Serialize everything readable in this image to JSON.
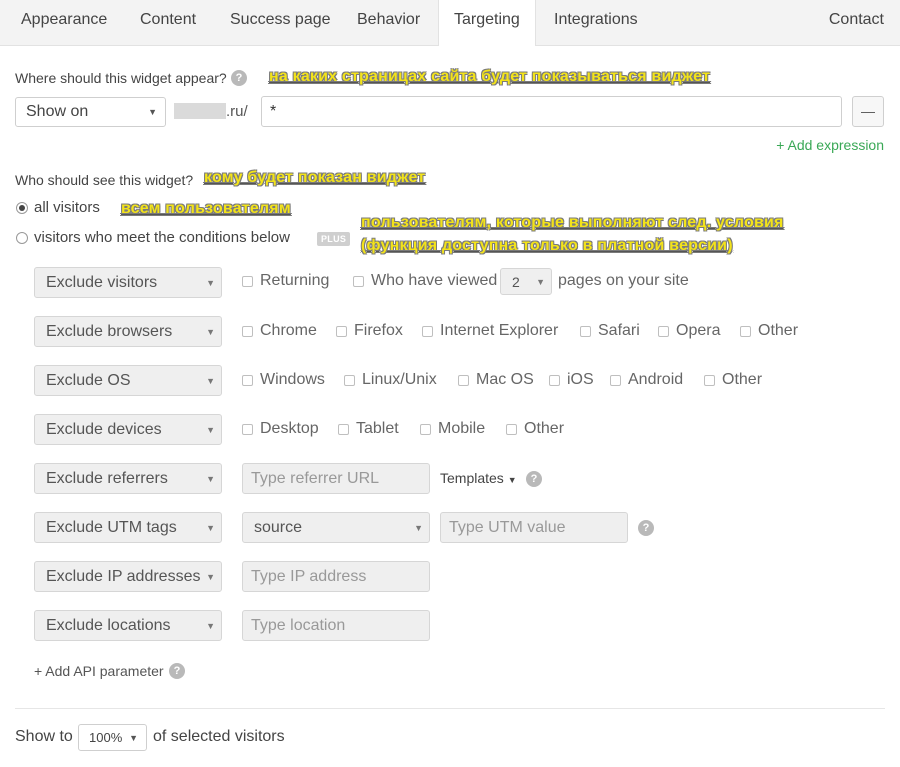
{
  "tabs": [
    "Appearance",
    "Content",
    "Success page",
    "Behavior",
    "Targeting",
    "Integrations"
  ],
  "contact": "Contact",
  "where": {
    "question": "Where should this widget appear?",
    "annotation": "на каких страницах сайта будет показываться виджет",
    "show_select": "Show on",
    "domain_suffix": ".ru/",
    "path_value": "*",
    "remove_button": "—",
    "add_expression": "+ Add expression"
  },
  "who": {
    "question": "Who should see this widget?",
    "annotation": "кому будет показан виджет",
    "all_label": "all visitors",
    "all_annotation": "всем пользователям",
    "conditions_label": "visitors who meet the conditions below",
    "plus_badge": "PLUS",
    "conditions_annotation_1": "пользователям, которые выполняют след. условия",
    "conditions_annotation_2": "(функция доступна только в платной версии)"
  },
  "rules": {
    "visitors": {
      "select": "Exclude visitors",
      "returning": "Returning",
      "viewed": "Who have viewed",
      "pages_count": "2",
      "pages_suffix": "pages on your site"
    },
    "browsers": {
      "select": "Exclude browsers",
      "options": [
        "Chrome",
        "Firefox",
        "Internet Explorer",
        "Safari",
        "Opera",
        "Other"
      ]
    },
    "os": {
      "select": "Exclude OS",
      "options": [
        "Windows",
        "Linux/Unix",
        "Mac OS",
        "iOS",
        "Android",
        "Other"
      ]
    },
    "devices": {
      "select": "Exclude devices",
      "options": [
        "Desktop",
        "Tablet",
        "Mobile",
        "Other"
      ]
    },
    "referrers": {
      "select": "Exclude referrers",
      "placeholder": "Type referrer URL",
      "templates": "Templates"
    },
    "utm": {
      "select": "Exclude UTM tags",
      "source": "source",
      "placeholder": "Type UTM value"
    },
    "ip": {
      "select": "Exclude IP addresses",
      "placeholder": "Type IP address"
    },
    "locations": {
      "select": "Exclude locations",
      "placeholder": "Type location"
    }
  },
  "add_api": "+ Add API parameter",
  "show_to": {
    "prefix": "Show to",
    "percent": "100%",
    "suffix": "of selected visitors"
  },
  "colors": {
    "accent_green": "#3aa856",
    "annotation_yellow": "#f3e31a"
  }
}
